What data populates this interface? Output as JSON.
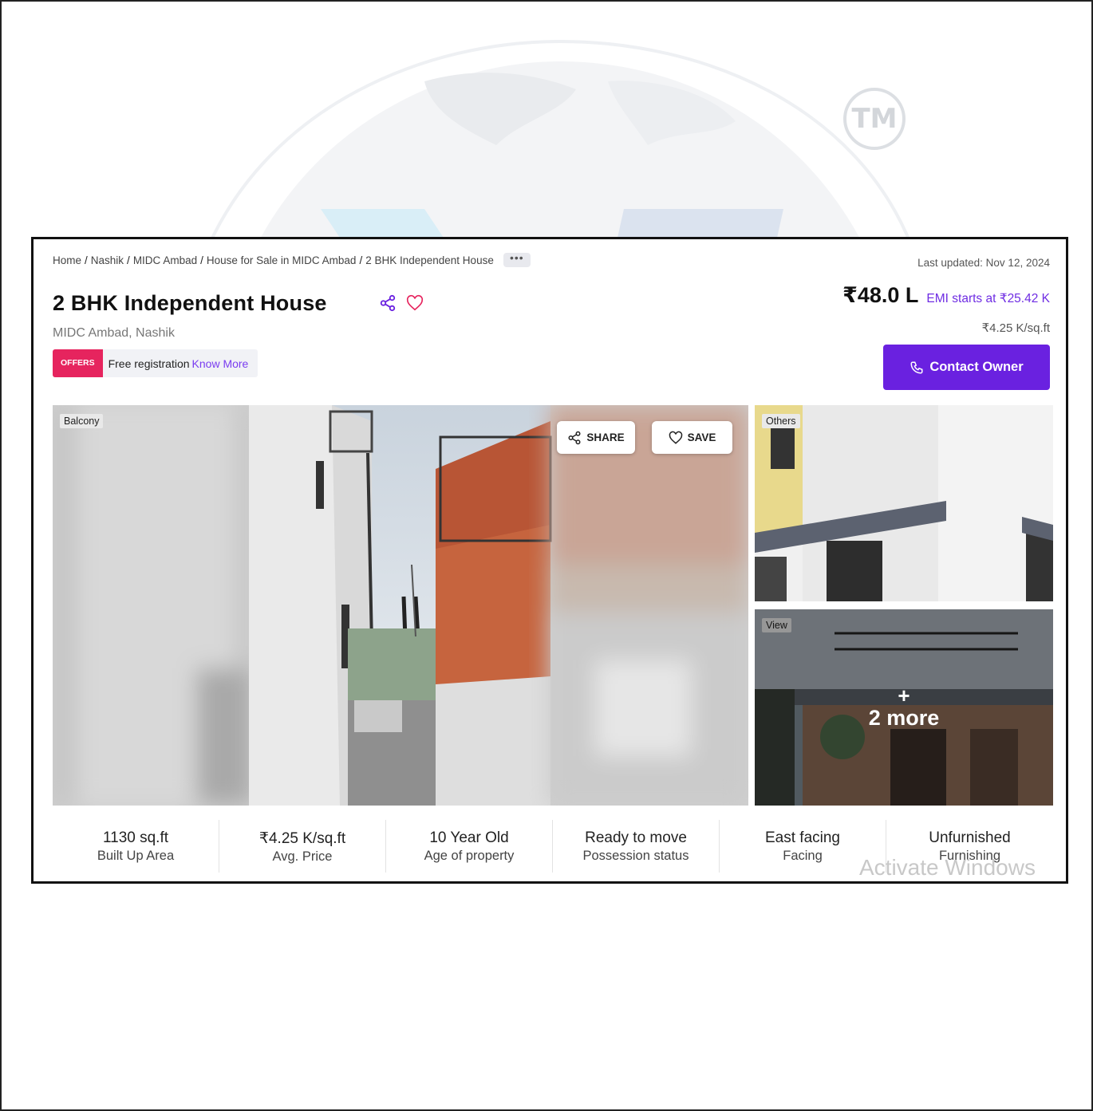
{
  "watermark": {
    "badge": "TM"
  },
  "breadcrumb": [
    "Home",
    "Nashik",
    "MIDC Ambad",
    "House for Sale in MIDC Ambad",
    "2 BHK Independent House"
  ],
  "breadcrumb_more": "•••",
  "last_updated": "Last updated: Nov 12, 2024",
  "property": {
    "title": "2 BHK Independent House",
    "location": "MIDC Ambad, Nashik",
    "price": "₹48.0 L",
    "emi": "EMI starts at ₹25.42 K",
    "price_per_sqft": "₹4.25 K/sq.ft"
  },
  "offer": {
    "badge": "OFFERS",
    "text": "Free registration",
    "link": "Know More"
  },
  "contact_button": "Contact Owner",
  "gallery": {
    "main_tag": "Balcony",
    "share_label": "SHARE",
    "save_label": "SAVE",
    "side_top_tag": "Others",
    "side_bottom_tag": "View",
    "more_plus": "+",
    "more_label": "2 more"
  },
  "stats": [
    {
      "value": "1130 sq.ft",
      "label": "Built Up Area"
    },
    {
      "value": "₹4.25 K/sq.ft",
      "label": "Avg. Price"
    },
    {
      "value": "10 Year Old",
      "label": "Age of property"
    },
    {
      "value": "Ready to move",
      "label": "Possession status"
    },
    {
      "value": "East facing",
      "label": "Facing"
    },
    {
      "value": "Unfurnished",
      "label": "Furnishing"
    }
  ],
  "os_overlay": "Activate Windows",
  "colors": {
    "accent": "#6a21e0",
    "offer_badge": "#e6245e",
    "link": "#7a3df0"
  },
  "icons": [
    "share-icon",
    "heart-icon",
    "phone-icon"
  ]
}
